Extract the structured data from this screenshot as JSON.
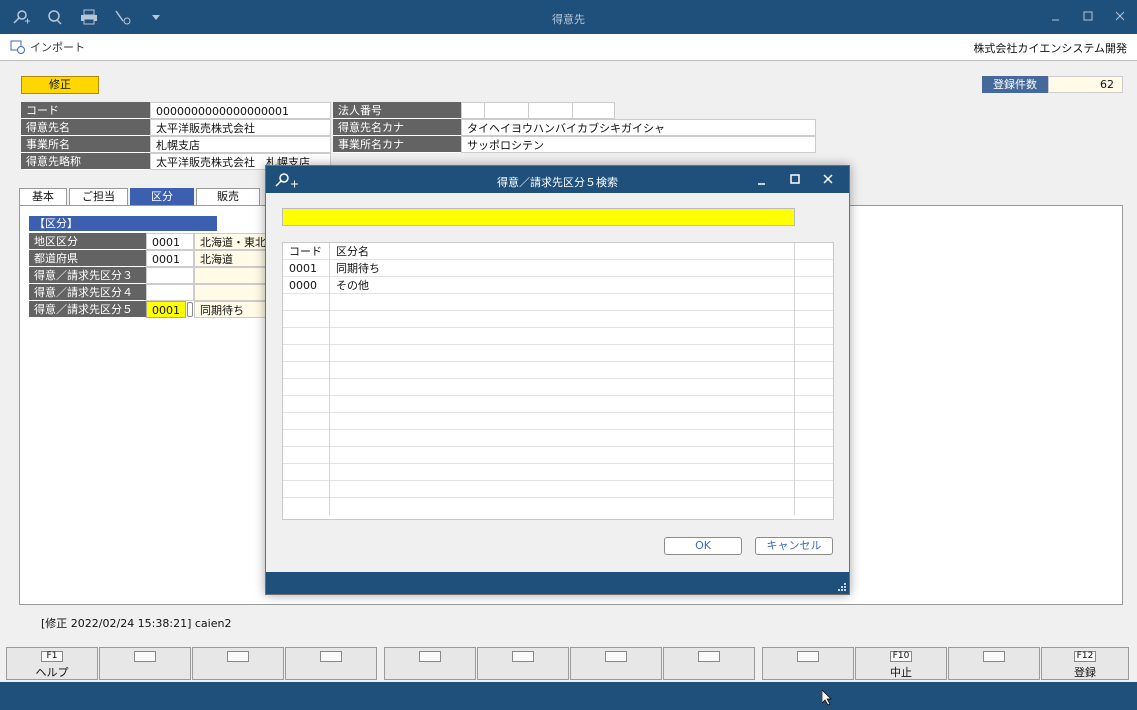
{
  "window": {
    "title": "得意先"
  },
  "menubar": {
    "import_label": "インポート",
    "company": "株式会社カイエンシステム開発"
  },
  "mode": "修正",
  "record_count": {
    "label": "登録件数",
    "value": "62"
  },
  "fields": [
    {
      "label": "コード",
      "value": "0000000000000000001"
    },
    {
      "label": "得意先名",
      "value": "太平洋販売株式会社"
    },
    {
      "label": "事業所名",
      "value": "札幌支店"
    },
    {
      "label": "得意先略称",
      "value": "太平洋販売株式会社　札幌支店"
    }
  ],
  "fields_right": [
    {
      "label": "法人番号",
      "value": ""
    },
    {
      "label": "得意先名カナ",
      "value": "タイヘイヨウハンバイカブシキガイシャ"
    },
    {
      "label": "事業所名カナ",
      "value": "サッポロシテン"
    }
  ],
  "tabs": [
    "基本",
    "ご担当",
    "区分",
    "販売"
  ],
  "section_title": "【区分】",
  "kubun_rows": [
    {
      "label": "地区区分",
      "code": "0001",
      "name": "北海道・東北"
    },
    {
      "label": "都道府県",
      "code": "0001",
      "name": "北海道"
    },
    {
      "label": "得意／請求先区分３",
      "code": "",
      "name": ""
    },
    {
      "label": "得意／請求先区分４",
      "code": "",
      "name": ""
    },
    {
      "label": "得意／請求先区分５",
      "code": "0001",
      "name": "同期待ち"
    }
  ],
  "status_line": "[修正 2022/02/24 15:38:21] caien2",
  "fkeys": [
    {
      "cap": "F1",
      "name": "ヘルプ"
    },
    {
      "cap": "",
      "name": ""
    },
    {
      "cap": "",
      "name": ""
    },
    {
      "cap": "",
      "name": ""
    },
    {
      "cap": "",
      "name": ""
    },
    {
      "cap": "",
      "name": ""
    },
    {
      "cap": "",
      "name": ""
    },
    {
      "cap": "",
      "name": ""
    },
    {
      "cap": "",
      "name": ""
    },
    {
      "cap": "F10",
      "name": "中止"
    },
    {
      "cap": "",
      "name": ""
    },
    {
      "cap": "F12",
      "name": "登録"
    }
  ],
  "dialog": {
    "title": "得意／請求先区分５検索",
    "search_value": "",
    "columns": [
      "コード",
      "区分名"
    ],
    "rows": [
      {
        "code": "0001",
        "name": "同期待ち"
      },
      {
        "code": "0000",
        "name": "その他"
      }
    ],
    "ok_label": "OK",
    "cancel_label": "キャンセル"
  },
  "colors": {
    "titlebar": "#1f4f7b",
    "accent_blue": "#3d5fb0",
    "highlight_yellow": "#ffff00",
    "mode_yellow": "#ffd700",
    "label_gray": "#636363"
  }
}
